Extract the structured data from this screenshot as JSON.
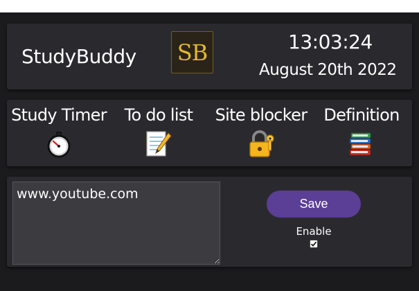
{
  "header": {
    "app_name": "StudyBuddy",
    "logo_text": "SB",
    "time": "13:03:24",
    "date": "August 20th 2022"
  },
  "nav": {
    "items": [
      {
        "label": "Study Timer",
        "icon": "stopwatch-icon"
      },
      {
        "label": "To do list",
        "icon": "memo-icon"
      },
      {
        "label": "Site blocker",
        "icon": "lock-with-key-icon"
      },
      {
        "label": "Definition",
        "icon": "books-icon"
      }
    ]
  },
  "blocker": {
    "sites_value": "www.youtube.com",
    "save_label": "Save",
    "enable_label": "Enable",
    "enable_checked": true
  },
  "colors": {
    "background": "#1b1b1d",
    "panel": "#2a2a2e",
    "accent": "#5b3e96",
    "logo_gold": "#e2b830"
  }
}
